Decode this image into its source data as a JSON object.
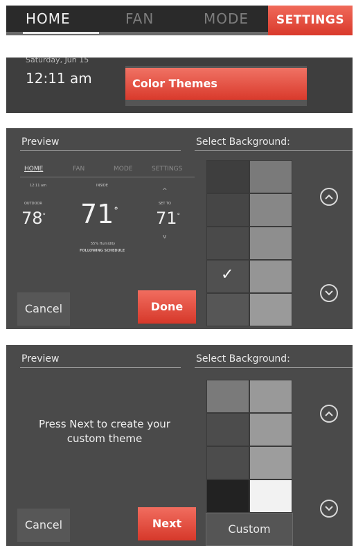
{
  "nav": {
    "tabs": [
      {
        "label": "HOME",
        "active": true
      },
      {
        "label": "FAN",
        "active": false
      },
      {
        "label": "MODE",
        "active": false
      }
    ],
    "settings_label": "SETTINGS"
  },
  "status": {
    "date": "Saturday, Jun 15",
    "time": "12:11 am"
  },
  "menu": {
    "selected_item": "Color Themes"
  },
  "preview_panel": {
    "preview_label": "Preview",
    "select_background_label": "Select Background:",
    "mini_screen": {
      "tabs": [
        "HOME",
        "FAN",
        "MODE",
        "SETTINGS"
      ],
      "time": "12:11 am",
      "inside_label": "INSIDE",
      "outdoor_label": "OUTDOOR",
      "set_to_label": "SET TO",
      "outdoor_temp": "78",
      "indoor_temp": "71",
      "setpoint": "71",
      "degree": "°",
      "humidity": "55% Humidity",
      "schedule": "FOLLOWING SCHEDULE",
      "up_arrow": "^",
      "down_arrow": "v"
    },
    "cancel_label": "Cancel",
    "done_label": "Done",
    "checkmark": "✓",
    "selected_swatch_row": 3,
    "swatch_colors_left": [
      "#3e3e3e",
      "#464646",
      "#4a4a4a",
      "#505050",
      "#565656"
    ],
    "swatch_colors_right": [
      "#7a7a7a",
      "#878787",
      "#8e8e8e",
      "#959595",
      "#9a9a9a"
    ],
    "scroll_up_icon": "chevron-up",
    "scroll_down_icon": "chevron-down"
  },
  "custom_panel": {
    "preview_label": "Preview",
    "select_background_label": "Select Background:",
    "message": "Press Next to create your custom theme",
    "cancel_label": "Cancel",
    "next_label": "Next",
    "custom_label": "Custom",
    "swatch_colors_left": [
      "#7a7a7a",
      "#4c4c4c",
      "#4c4c4c",
      "#222222"
    ],
    "swatch_colors_right": [
      "#999999",
      "#9a9a9a",
      "#9d9d9d",
      "#f2f2f2"
    ]
  },
  "colors": {
    "accent_red": "#e0463a",
    "panel_bg": "#4a4a4a",
    "nav_bg": "#2a2a2a"
  }
}
